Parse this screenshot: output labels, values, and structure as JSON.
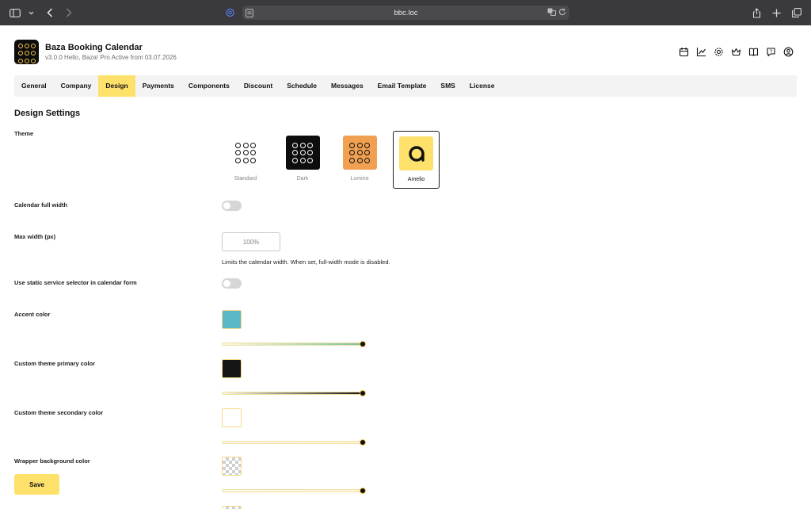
{
  "browser": {
    "url": "bbc.loc"
  },
  "app": {
    "title": "Baza Booking Calendar",
    "subtitle": "v3.0.0 Hello, Baza! Pro Active from 03.07.2026"
  },
  "tabs": [
    {
      "label": "General"
    },
    {
      "label": "Company"
    },
    {
      "label": "Design",
      "active": true
    },
    {
      "label": "Payments"
    },
    {
      "label": "Components"
    },
    {
      "label": "Discount"
    },
    {
      "label": "Schedule"
    },
    {
      "label": "Messages"
    },
    {
      "label": "Email Template"
    },
    {
      "label": "SMS"
    },
    {
      "label": "License"
    }
  ],
  "section_title": "Design Settings",
  "settings": {
    "theme_label": "Theme",
    "themes": [
      {
        "name": "Standard",
        "color": "#ffffff",
        "selected": false
      },
      {
        "name": "Dark",
        "color": "#0d0d0d",
        "selected": false
      },
      {
        "name": "Lumino",
        "color": "#f0a050",
        "selected": false
      },
      {
        "name": "Amelio",
        "color": "#fde16b",
        "selected": true
      }
    ],
    "full_width_label": "Calendar full width",
    "full_width_on": false,
    "max_width_label": "Max width (px)",
    "max_width_placeholder": "100%",
    "max_width_hint": "Limits the calendar width. When set, full-width mode is disabled.",
    "static_selector_label": "Use static service selector in calendar form",
    "static_selector_on": false,
    "accent_label": "Accent color",
    "accent_color": "#5bb8c9",
    "primary_label": "Custom theme primary color",
    "primary_color": "#151515",
    "secondary_label": "Custom theme secondary color",
    "secondary_color": "#ffffff",
    "wrapper_label": "Wrapper background color",
    "wrapper_color": "transparent"
  },
  "save_label": "Save",
  "colors": {
    "accent_yellow": "#fde16b",
    "tab_bar_bg": "#f3f3f3"
  }
}
